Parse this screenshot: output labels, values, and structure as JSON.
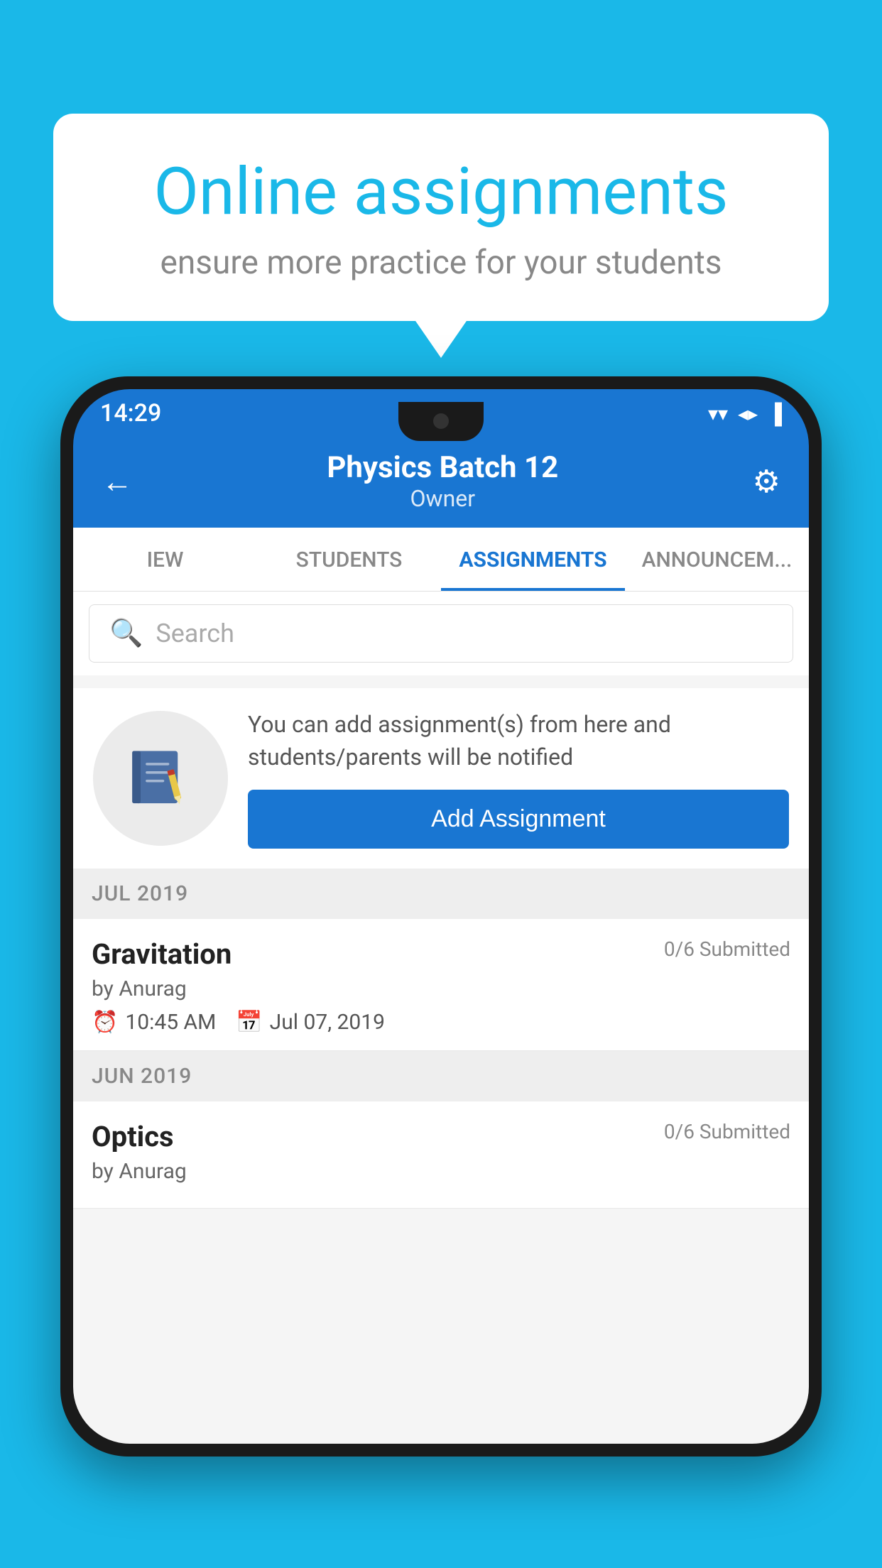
{
  "background_color": "#1ab8e8",
  "speech_bubble": {
    "title": "Online assignments",
    "subtitle": "ensure more practice for your students"
  },
  "status_bar": {
    "time": "14:29",
    "wifi_icon": "▼",
    "signal_icon": "▲",
    "battery_icon": "▌"
  },
  "header": {
    "title": "Physics Batch 12",
    "subtitle": "Owner",
    "back_label": "←",
    "settings_label": "⚙"
  },
  "tabs": [
    {
      "label": "IEW",
      "active": false
    },
    {
      "label": "STUDENTS",
      "active": false
    },
    {
      "label": "ASSIGNMENTS",
      "active": true
    },
    {
      "label": "ANNOUNCEM...",
      "active": false
    }
  ],
  "search": {
    "placeholder": "Search"
  },
  "info_card": {
    "description": "You can add assignment(s) from here and students/parents will be notified",
    "button_label": "Add Assignment"
  },
  "sections": [
    {
      "label": "JUL 2019",
      "assignments": [
        {
          "name": "Gravitation",
          "submitted": "0/6 Submitted",
          "by": "by Anurag",
          "time": "10:45 AM",
          "date": "Jul 07, 2019"
        }
      ]
    },
    {
      "label": "JUN 2019",
      "assignments": [
        {
          "name": "Optics",
          "submitted": "0/6 Submitted",
          "by": "by Anurag",
          "time": "",
          "date": ""
        }
      ]
    }
  ]
}
